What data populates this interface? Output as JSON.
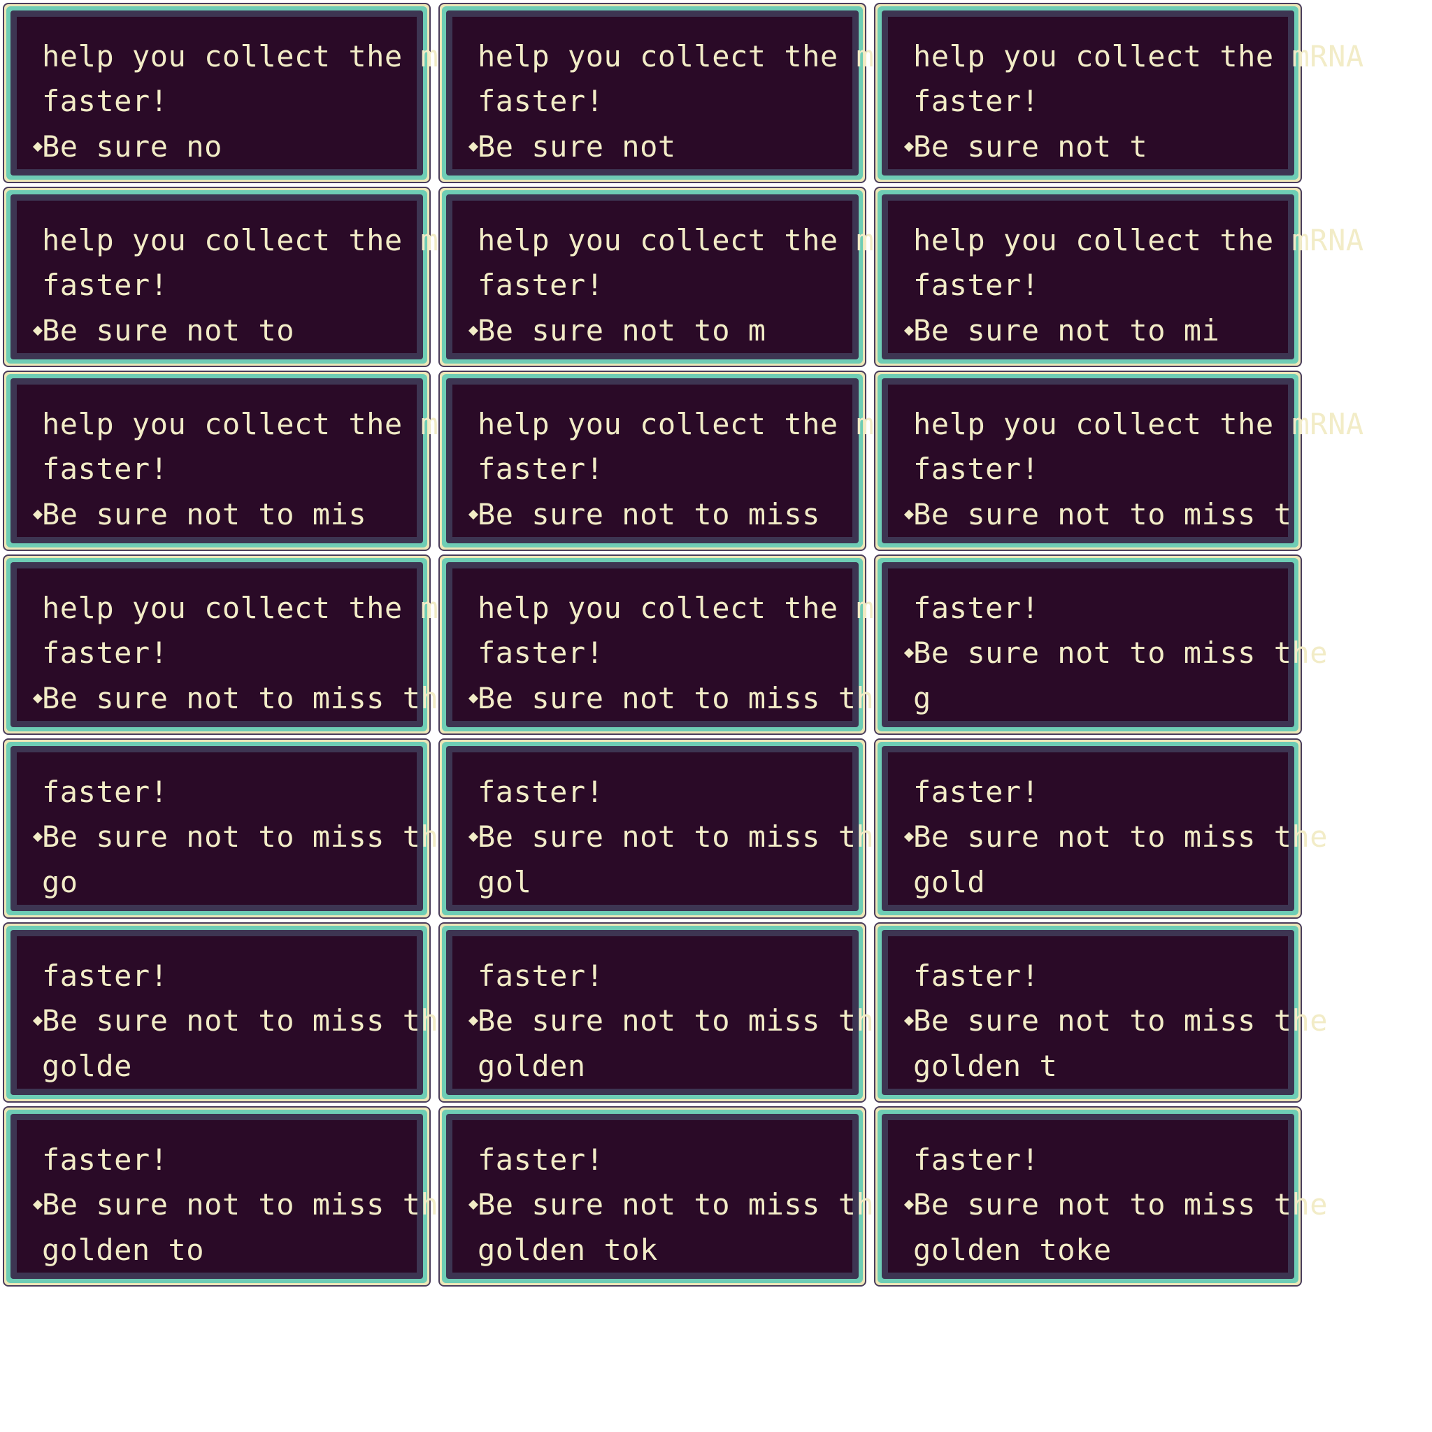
{
  "colors": {
    "background": "#ffffff",
    "outer_border": "#4a3d5c",
    "cream_rim": "#ede7b8",
    "teal_rim": "#6ecdb5",
    "inner_border": "#3d3552",
    "panel_fill": "#2a0a27",
    "text": "#f2ecc7"
  },
  "bullet_icon": "bullet-diamond-icon",
  "frames": [
    {
      "lines": [
        "help you collect the mRNA",
        "faster!",
        "Be sure no"
      ],
      "bullet_line": 2
    },
    {
      "lines": [
        "help you collect the mRNA",
        "faster!",
        "Be sure not"
      ],
      "bullet_line": 2
    },
    {
      "lines": [
        "help you collect the mRNA",
        "faster!",
        "Be sure not t"
      ],
      "bullet_line": 2
    },
    {
      "lines": [
        "help you collect the mRNA",
        "faster!",
        "Be sure not to"
      ],
      "bullet_line": 2
    },
    {
      "lines": [
        "help you collect the mRNA",
        "faster!",
        "Be sure not to m"
      ],
      "bullet_line": 2
    },
    {
      "lines": [
        "help you collect the mRNA",
        "faster!",
        "Be sure not to mi"
      ],
      "bullet_line": 2
    },
    {
      "lines": [
        "help you collect the mRNA",
        "faster!",
        "Be sure not to mis"
      ],
      "bullet_line": 2
    },
    {
      "lines": [
        "help you collect the mRNA",
        "faster!",
        "Be sure not to miss"
      ],
      "bullet_line": 2
    },
    {
      "lines": [
        "help you collect the mRNA",
        "faster!",
        "Be sure not to miss t"
      ],
      "bullet_line": 2
    },
    {
      "lines": [
        "help you collect the mRNA",
        "faster!",
        "Be sure not to miss th"
      ],
      "bullet_line": 2
    },
    {
      "lines": [
        "help you collect the mRNA",
        "faster!",
        "Be sure not to miss the"
      ],
      "bullet_line": 2
    },
    {
      "lines": [
        "faster!",
        "Be sure not to miss the",
        "g"
      ],
      "bullet_line": 1
    },
    {
      "lines": [
        "faster!",
        "Be sure not to miss the",
        "go"
      ],
      "bullet_line": 1
    },
    {
      "lines": [
        "faster!",
        "Be sure not to miss the",
        "gol"
      ],
      "bullet_line": 1
    },
    {
      "lines": [
        "faster!",
        "Be sure not to miss the",
        "gold"
      ],
      "bullet_line": 1
    },
    {
      "lines": [
        "faster!",
        "Be sure not to miss the",
        "golde"
      ],
      "bullet_line": 1
    },
    {
      "lines": [
        "faster!",
        "Be sure not to miss the",
        "golden"
      ],
      "bullet_line": 1
    },
    {
      "lines": [
        "faster!",
        "Be sure not to miss the",
        "golden t"
      ],
      "bullet_line": 1
    },
    {
      "lines": [
        "faster!",
        "Be sure not to miss the",
        "golden to"
      ],
      "bullet_line": 1
    },
    {
      "lines": [
        "faster!",
        "Be sure not to miss the",
        "golden tok"
      ],
      "bullet_line": 1
    },
    {
      "lines": [
        "faster!",
        "Be sure not to miss the",
        "golden toke"
      ],
      "bullet_line": 1
    }
  ]
}
